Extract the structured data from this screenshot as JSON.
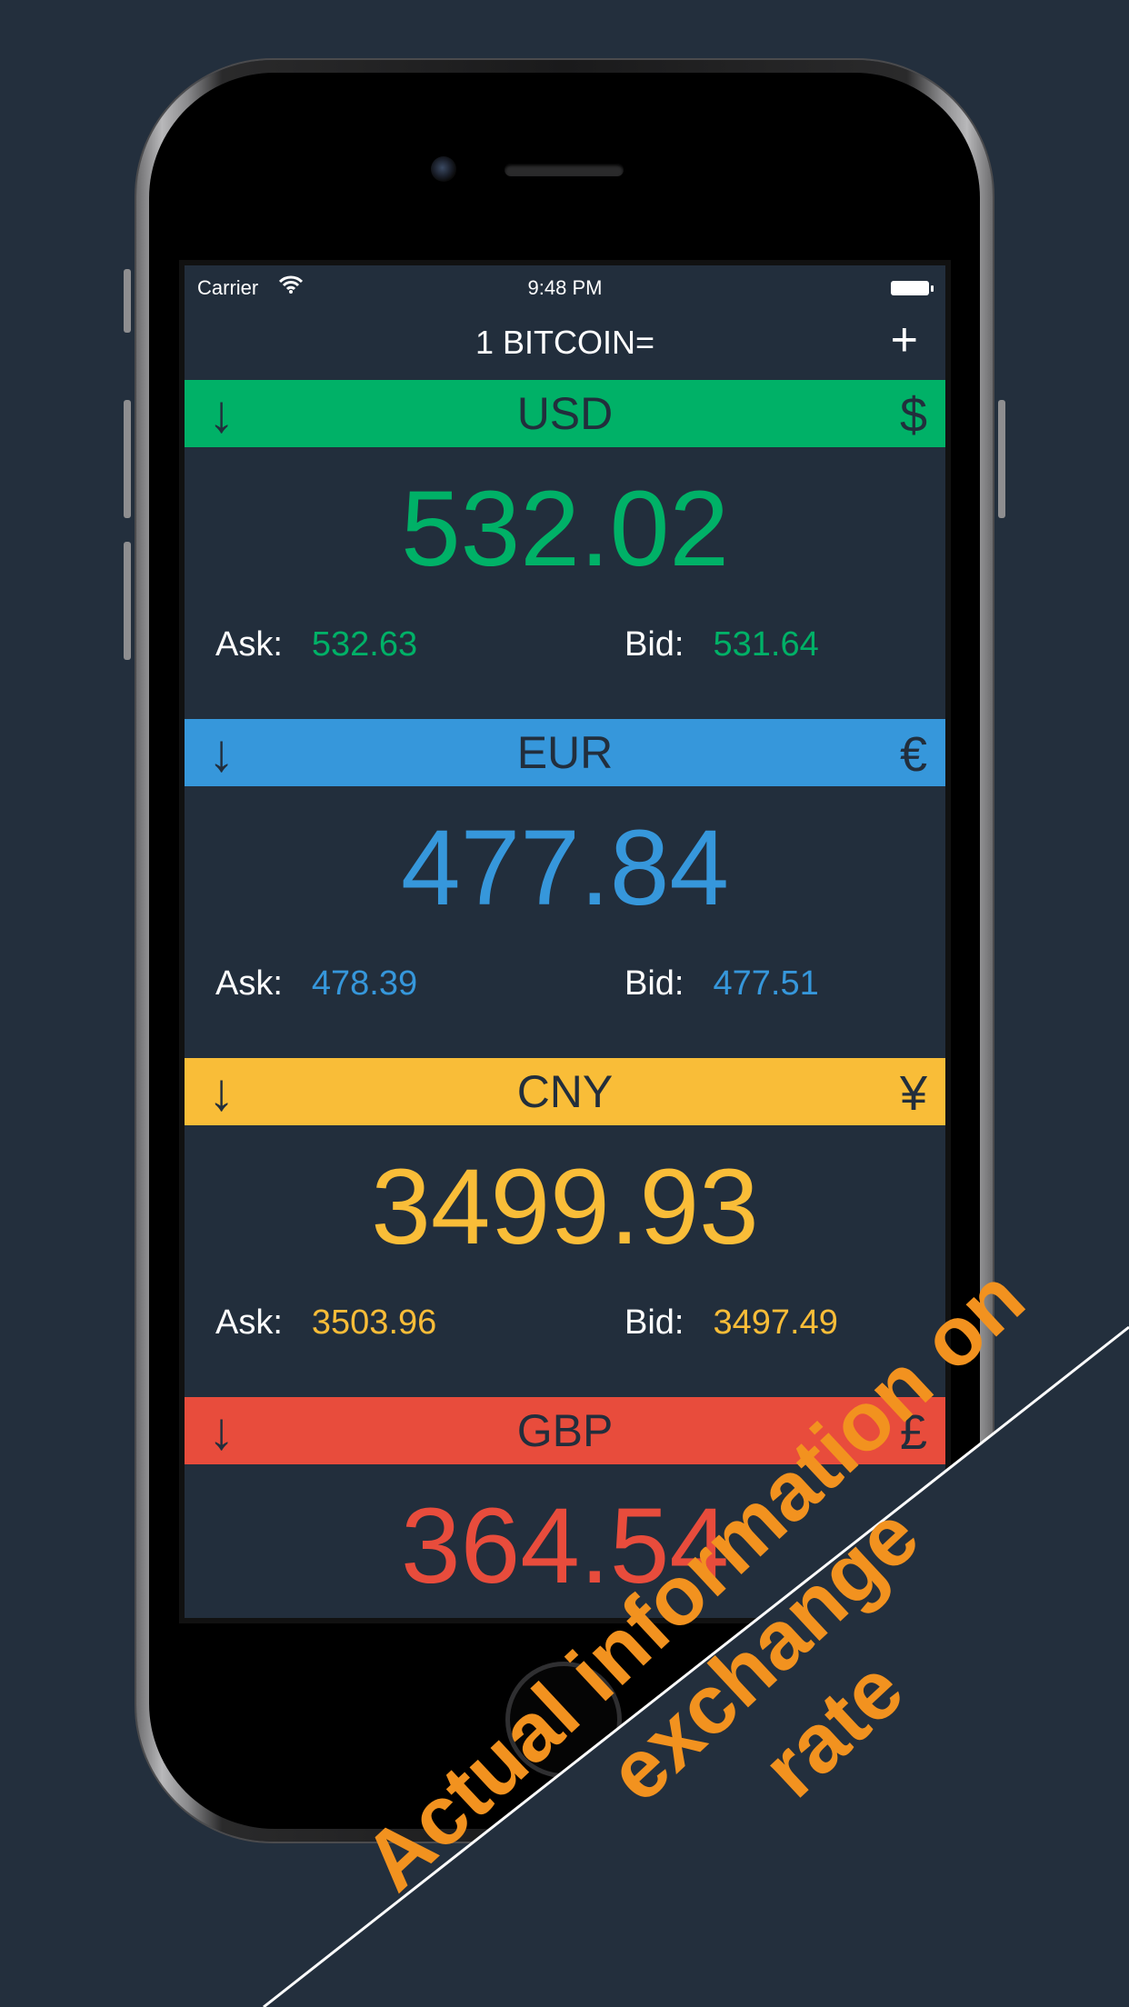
{
  "status_bar": {
    "carrier": "Carrier",
    "time": "9:48 PM"
  },
  "nav": {
    "title": "1 BITCOIN=",
    "add_label": "+"
  },
  "currencies": [
    {
      "code": "USD",
      "symbol": "$",
      "arrow": "↓",
      "rate": "532.02",
      "ask_label": "Ask:",
      "ask": "532.63",
      "bid_label": "Bid:",
      "bid": "531.64",
      "color": "#00b167"
    },
    {
      "code": "EUR",
      "symbol": "€",
      "arrow": "↓",
      "rate": "477.84",
      "ask_label": "Ask:",
      "ask": "478.39",
      "bid_label": "Bid:",
      "bid": "477.51",
      "color": "#3697db"
    },
    {
      "code": "CNY",
      "symbol": "¥",
      "arrow": "↓",
      "rate": "3499.93",
      "ask_label": "Ask:",
      "ask": "3503.96",
      "bid_label": "Bid:",
      "bid": "3497.49",
      "color": "#f9bd38"
    },
    {
      "code": "GBP",
      "symbol": "£",
      "arrow": "↓",
      "rate": "364.54",
      "color": "#e84c3c"
    }
  ],
  "banner": {
    "lines": [
      "Actual information on",
      "exchange",
      "rate"
    ],
    "color": "#f2921f"
  }
}
